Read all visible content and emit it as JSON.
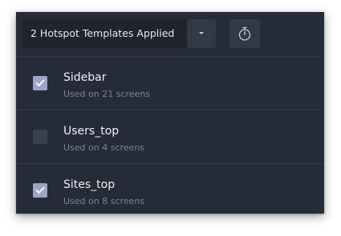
{
  "toolbar": {
    "dropdown_label": "2 Hotspot Templates Applied",
    "dropdown_toggle_icon": "caret-down-icon",
    "timer_icon": "stopwatch-icon"
  },
  "templates": [
    {
      "name": "Sidebar",
      "usage": "Used on 21 screens",
      "checked": true
    },
    {
      "name": "Users_top",
      "usage": "Used on 4 screens",
      "checked": false
    },
    {
      "name": "Sites_top",
      "usage": "Used on 8 screens",
      "checked": true
    }
  ],
  "colors": {
    "panel_bg": "#262c37",
    "checkbox_checked": "#9aa6c6",
    "checkbox_unchecked": "#3a414d"
  }
}
